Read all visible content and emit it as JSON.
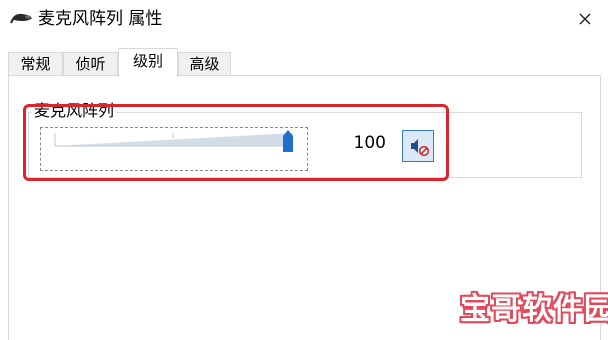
{
  "window": {
    "title": "麦克风阵列 属性",
    "app_icon": "microphone-app-icon",
    "close_icon": "close-icon"
  },
  "tabs": [
    {
      "label": "常规",
      "active": false
    },
    {
      "label": "侦听",
      "active": false
    },
    {
      "label": "级别",
      "active": true
    },
    {
      "label": "高级",
      "active": false
    }
  ],
  "levels": {
    "group_label": "麦克风阵列",
    "slider_value": 100,
    "slider_fraction": 1.0,
    "value_text": "100",
    "mute_button_icon": "speaker-muted-icon"
  },
  "colors": {
    "highlight": "#d8262f",
    "slider_thumb": "#1f6fd1",
    "watermark": "#e24a5c"
  },
  "watermark": {
    "text": "宝哥软件园"
  }
}
